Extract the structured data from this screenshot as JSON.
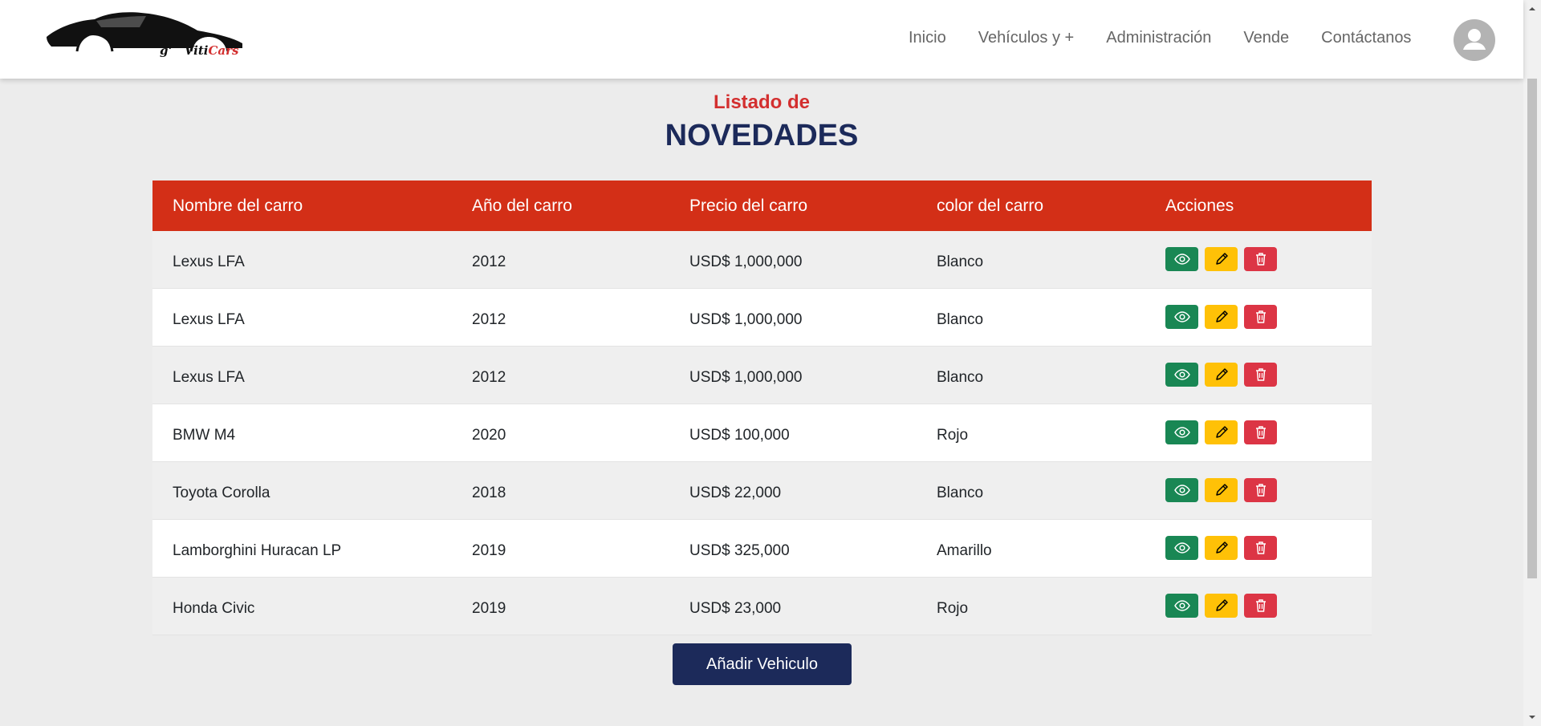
{
  "logo": {
    "prefix": "g'",
    "name": "Viti",
    "brand": "Cars"
  },
  "nav": {
    "items": [
      "Inicio",
      "Vehículos y +",
      "Administración",
      "Vende",
      "Contáctanos"
    ]
  },
  "page": {
    "subtitle": "Listado de",
    "title": "NOVEDADES"
  },
  "table": {
    "headers": [
      "Nombre del carro",
      "Año del carro",
      "Precio del carro",
      "color del carro",
      "Acciones"
    ],
    "rows": [
      [
        "Lexus LFA",
        "2012",
        "USD$ 1,000,000",
        "Blanco"
      ],
      [
        "Lexus LFA",
        "2012",
        "USD$ 1,000,000",
        "Blanco"
      ],
      [
        "Lexus LFA",
        "2012",
        "USD$ 1,000,000",
        "Blanco"
      ],
      [
        "BMW M4",
        "2020",
        "USD$ 100,000",
        "Rojo"
      ],
      [
        "Toyota Corolla",
        "2018",
        "USD$ 22,000",
        "Blanco"
      ],
      [
        "Lamborghini Huracan LP",
        "2019",
        "USD$ 325,000",
        "Amarillo"
      ],
      [
        "Honda Civic",
        "2019",
        "USD$ 23,000",
        "Rojo"
      ]
    ],
    "actions": [
      "eye-icon",
      "pencil-icon",
      "trash-icon"
    ]
  },
  "add_button": "Añadir Vehiculo",
  "colors": {
    "accent_red": "#d32f17",
    "navy": "#1c2a5a",
    "view": "#198754",
    "edit": "#ffc107",
    "delete": "#dc3545"
  }
}
